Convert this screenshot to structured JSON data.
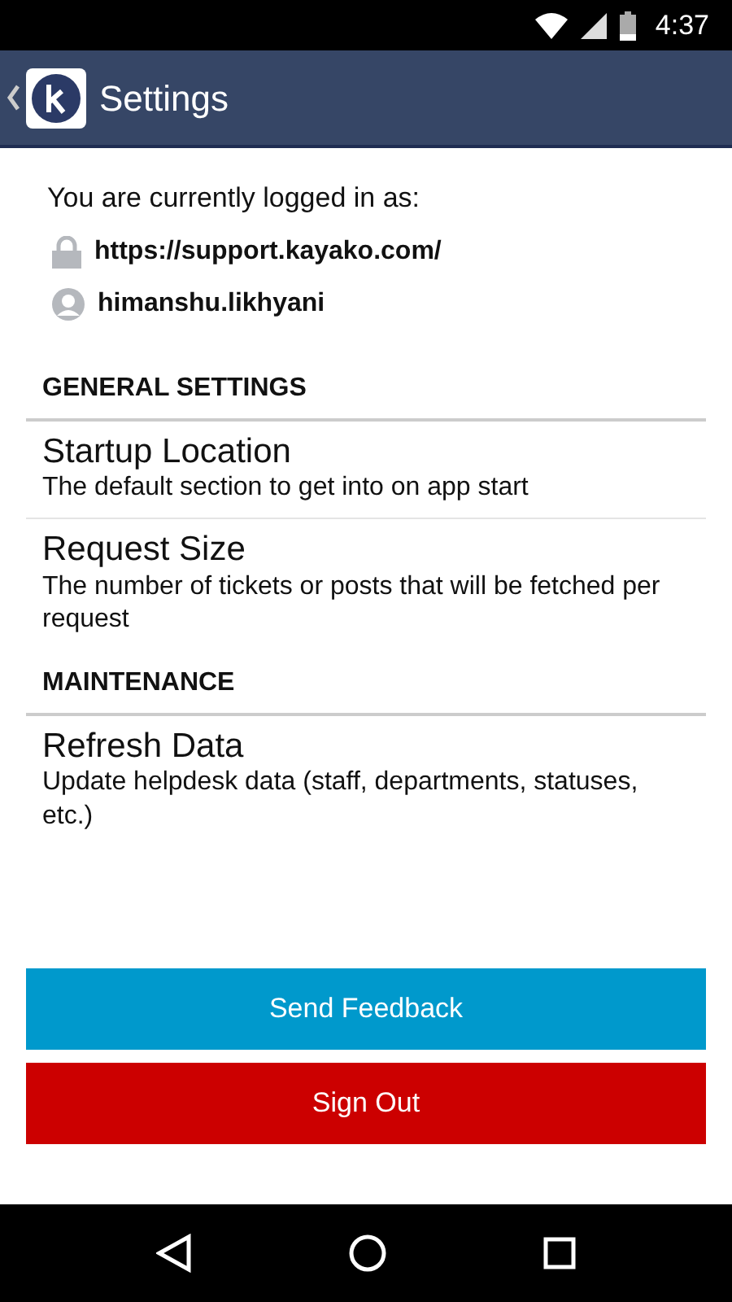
{
  "status_bar": {
    "time": "4:37"
  },
  "app_bar": {
    "title": "Settings"
  },
  "login": {
    "intro": "You are currently logged in as:",
    "site": "https://support.kayako.com/",
    "user": "himanshu.likhyani"
  },
  "sections": [
    {
      "heading": "GENERAL SETTINGS",
      "items": [
        {
          "title": "Startup Location",
          "description": "The default section to get into on app start"
        },
        {
          "title": "Request Size",
          "description": "The number of tickets or posts that will be fetched per request"
        }
      ]
    },
    {
      "heading": "MAINTENANCE",
      "items": [
        {
          "title": "Refresh Data",
          "description": "Update helpdesk data (staff, departments, statuses, etc.)"
        }
      ]
    }
  ],
  "buttons": [
    {
      "label": "Send Feedback",
      "kind": "primary"
    },
    {
      "label": "Sign Out",
      "kind": "danger"
    }
  ]
}
